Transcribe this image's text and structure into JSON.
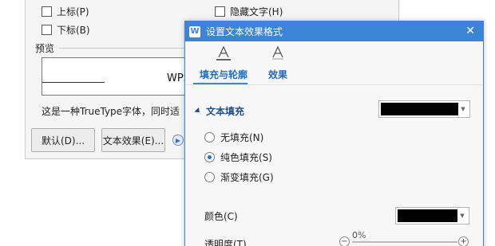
{
  "font_dialog": {
    "checkboxes": [
      {
        "label": "上标(P)"
      },
      {
        "label": "隐藏文字(H)"
      },
      {
        "label": "下标(B)"
      }
    ],
    "preview_label": "预览",
    "preview_text": "WPS",
    "description": "这是一种TrueType字体，同时适",
    "buttons": {
      "default": "默认(D)...",
      "text_effect": "文本效果(E)..."
    }
  },
  "panel": {
    "title": "设置文本效果格式",
    "tabs": [
      {
        "label": "填充与轮廓",
        "active": true
      },
      {
        "label": "效果",
        "active": false
      }
    ],
    "section_title": "文本填充",
    "fill_color": "#000000",
    "radios": [
      {
        "label": "无填充(N)",
        "checked": false
      },
      {
        "label": "纯色填充(S)",
        "checked": true
      },
      {
        "label": "渐变填充(G)",
        "checked": false
      }
    ],
    "color_label": "颜色(C)",
    "color_value": "#000000",
    "transparency_label": "透明度(T)",
    "transparency_value": "0%",
    "transparency": 0
  },
  "colors": {
    "accent": "#3b84d6",
    "tab_active": "#1f6fc6"
  }
}
